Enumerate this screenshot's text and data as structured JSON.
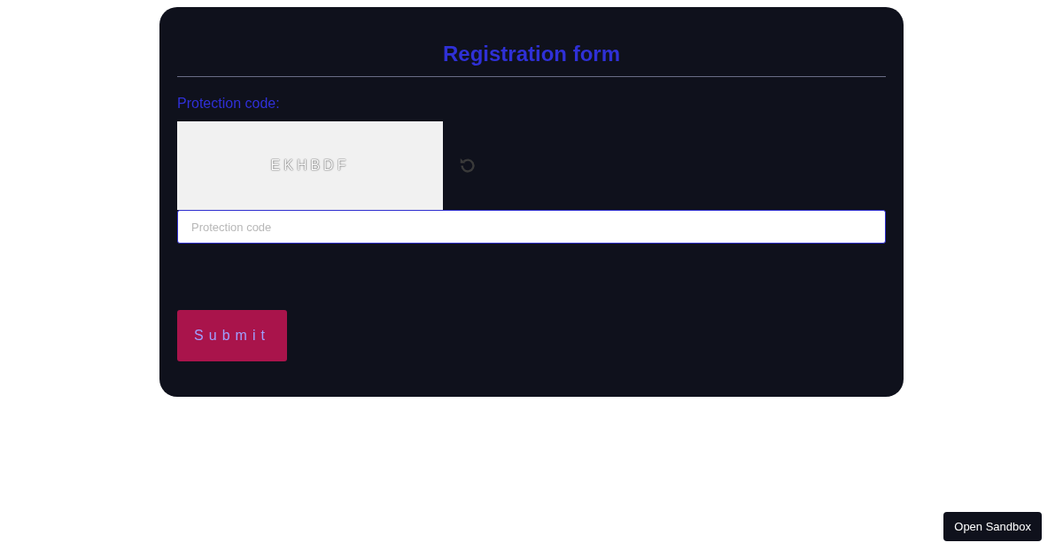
{
  "form": {
    "title": "Registration form",
    "label": "Protection code:",
    "captcha": "EKHBDF",
    "input": {
      "placeholder": "Protection code"
    },
    "submit": "Submit"
  },
  "sandbox_button": "Open Sandbox"
}
